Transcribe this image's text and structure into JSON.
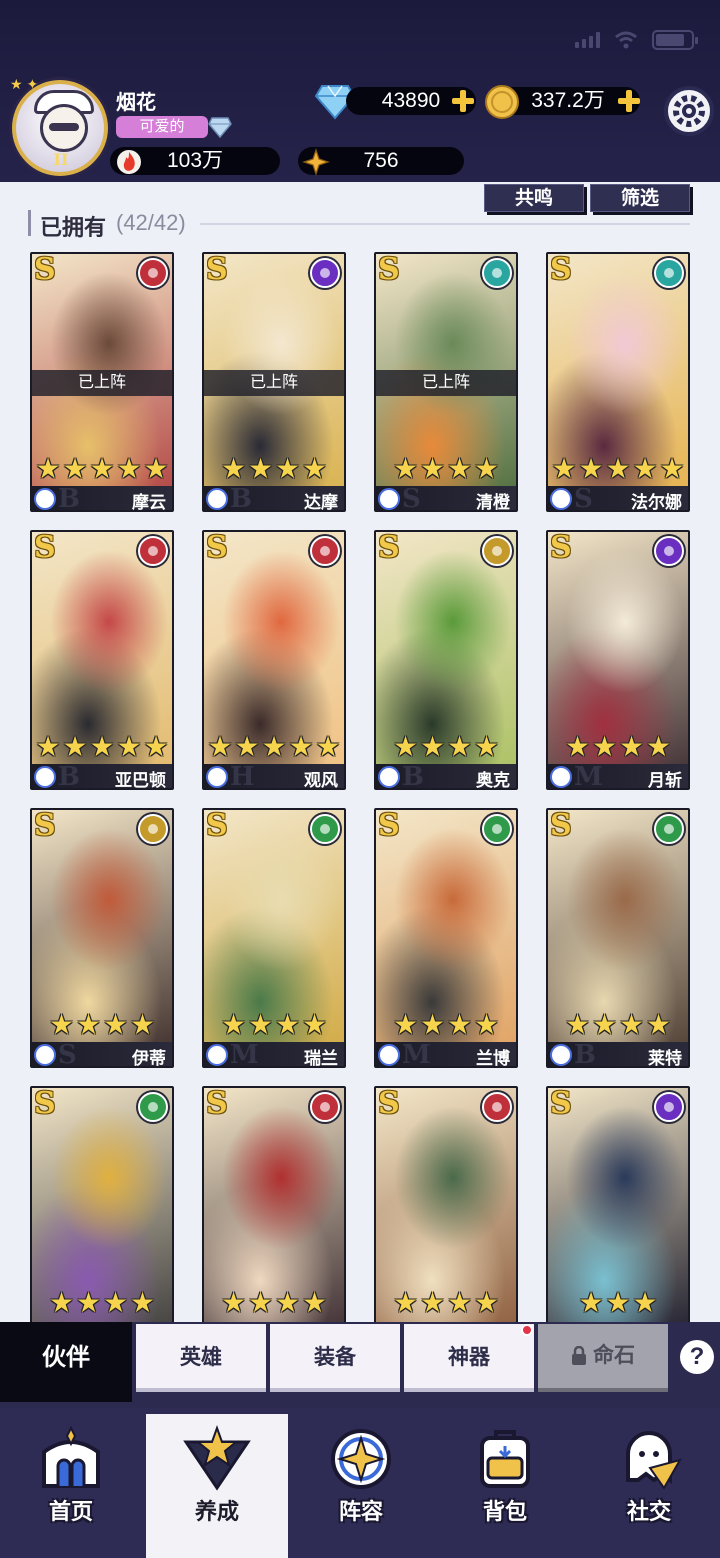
{
  "header": {
    "player_name": "烟花",
    "title_badge": "可爱的",
    "level_numeral": "II",
    "diamonds": "43890",
    "gold": "337.2万",
    "power": "103万",
    "essence": "756"
  },
  "toolbar": {
    "resonance_label": "共鸣",
    "filter_label": "筛选"
  },
  "collection": {
    "title": "已拥有",
    "count": "(42/42)"
  },
  "cards": [
    {
      "rank": "S",
      "name": "摩云",
      "stars": 5,
      "deployed": true,
      "deployed_label": "已上阵",
      "faction_color": "#c0303a",
      "class_letter": "B",
      "art_colors": [
        "#6b4a3a",
        "#e6c06a",
        "#b04040"
      ]
    },
    {
      "rank": "S",
      "name": "达摩",
      "stars": 4,
      "deployed": true,
      "deployed_label": "已上阵",
      "faction_color": "#6a2ec0",
      "class_letter": "B",
      "art_colors": [
        "#f3e7cf",
        "#2a2a36",
        "#d8b04a"
      ]
    },
    {
      "rank": "S",
      "name": "清橙",
      "stars": 4,
      "deployed": true,
      "deployed_label": "已上阵",
      "faction_color": "#2aa6a0",
      "class_letter": "S",
      "art_colors": [
        "#6a8a5a",
        "#e88a3a",
        "#4a6a3a"
      ]
    },
    {
      "rank": "S",
      "name": "法尔娜",
      "stars": 5,
      "deployed": false,
      "deployed_label": "",
      "faction_color": "#2aa6a0",
      "class_letter": "S",
      "art_colors": [
        "#f1c9d5",
        "#5a2a40",
        "#e4b04a"
      ]
    },
    {
      "rank": "S",
      "name": "亚巴顿",
      "stars": 5,
      "deployed": false,
      "deployed_label": "",
      "faction_color": "#c0303a",
      "class_letter": "B",
      "art_colors": [
        "#c44848",
        "#2a2a30",
        "#e2b86a"
      ]
    },
    {
      "rank": "S",
      "name": "观风",
      "stars": 5,
      "deployed": false,
      "deployed_label": "",
      "faction_color": "#c0303a",
      "class_letter": "H",
      "art_colors": [
        "#e06840",
        "#3a2a2a",
        "#f0c080"
      ]
    },
    {
      "rank": "S",
      "name": "奥克",
      "stars": 4,
      "deployed": false,
      "deployed_label": "",
      "faction_color": "#c49a2a",
      "class_letter": "B",
      "art_colors": [
        "#5a9a3a",
        "#2a3a2a",
        "#a8c060"
      ]
    },
    {
      "rank": "S",
      "name": "月斩",
      "stars": 4,
      "deployed": false,
      "deployed_label": "",
      "faction_color": "#6a2ec0",
      "class_letter": "M",
      "art_colors": [
        "#f4ead8",
        "#a03040",
        "#3a2a30"
      ]
    },
    {
      "rank": "S",
      "name": "伊蒂",
      "stars": 4,
      "deployed": false,
      "deployed_label": "",
      "faction_color": "#c49a2a",
      "class_letter": "S",
      "art_colors": [
        "#c05a3a",
        "#f0d8a0",
        "#3a2a28"
      ]
    },
    {
      "rank": "S",
      "name": "瑞兰",
      "stars": 4,
      "deployed": false,
      "deployed_label": "",
      "faction_color": "#2e9a4a",
      "class_letter": "M",
      "art_colors": [
        "#e8dcb0",
        "#4a7a4a",
        "#d0a840"
      ]
    },
    {
      "rank": "S",
      "name": "兰博",
      "stars": 4,
      "deployed": false,
      "deployed_label": "",
      "faction_color": "#2e9a4a",
      "class_letter": "M",
      "art_colors": [
        "#c86a3a",
        "#3a3a3a",
        "#e0a060"
      ]
    },
    {
      "rank": "S",
      "name": "莱特",
      "stars": 4,
      "deployed": false,
      "deployed_label": "",
      "faction_color": "#2e9a4a",
      "class_letter": "B",
      "art_colors": [
        "#9a6a4a",
        "#e8d8b0",
        "#4a3a30"
      ]
    },
    {
      "rank": "S",
      "name": "",
      "stars": 4,
      "deployed": false,
      "deployed_label": "",
      "faction_color": "#2e9a4a",
      "class_letter": "",
      "art_colors": [
        "#e0b040",
        "#8a5ab0",
        "#3a3a3a"
      ]
    },
    {
      "rank": "S",
      "name": "",
      "stars": 4,
      "deployed": false,
      "deployed_label": "",
      "faction_color": "#c0303a",
      "class_letter": "",
      "art_colors": [
        "#b03030",
        "#f0d8c0",
        "#3a2a30"
      ]
    },
    {
      "rank": "S",
      "name": "",
      "stars": 4,
      "deployed": false,
      "deployed_label": "",
      "faction_color": "#c0303a",
      "class_letter": "",
      "art_colors": [
        "#4a6a4a",
        "#f0e0c0",
        "#8a5a3a"
      ]
    },
    {
      "rank": "S",
      "name": "",
      "stars": 3,
      "deployed": false,
      "deployed_label": "",
      "faction_color": "#6a2ec0",
      "class_letter": "",
      "art_colors": [
        "#2a3a5a",
        "#7ac0d0",
        "#1a1a2a"
      ]
    }
  ],
  "subtabs": {
    "partner": "伙伴",
    "heroes": "英雄",
    "equipment": "装备",
    "artifacts": "神器",
    "fate_stone": "命石",
    "help": "?"
  },
  "nav": {
    "home": "首页",
    "train": "养成",
    "lineup": "阵容",
    "backpack": "背包",
    "social": "社交"
  }
}
